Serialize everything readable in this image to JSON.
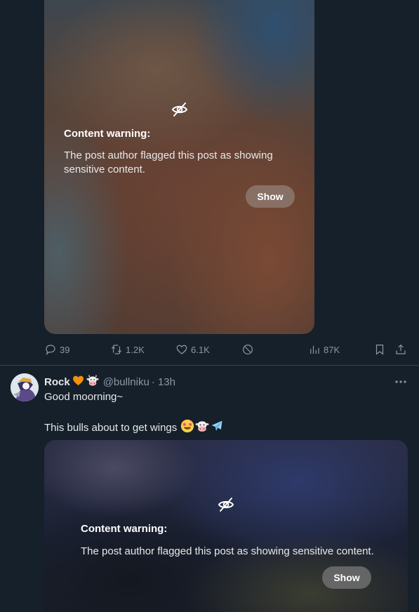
{
  "post1": {
    "warning_title": "Content warning:",
    "warning_text": "The post author flagged this post as showing sensitive content.",
    "show_label": "Show",
    "icon": "eye-slash-icon",
    "actions": {
      "replies": "39",
      "reposts": "1.2K",
      "likes": "6.1K",
      "views": "87K"
    }
  },
  "post2": {
    "display_name": "Rock",
    "name_emojis": [
      "orange-heart",
      "cow-face"
    ],
    "handle": "@bullniku",
    "time": "· 13h",
    "text_line1": "Good moorning~",
    "text_line2": "This bulls about to get wings",
    "text_emojis": [
      "star-struck",
      "cow-face",
      "airplane"
    ],
    "warning_title": "Content warning:",
    "warning_text": "The post author flagged this post as showing sensitive content.",
    "show_label": "Show",
    "icon": "eye-slash-icon"
  },
  "colors": {
    "background": "#15202b",
    "text": "#e7e9ea",
    "muted": "#8b98a5",
    "divider": "#38444d"
  }
}
